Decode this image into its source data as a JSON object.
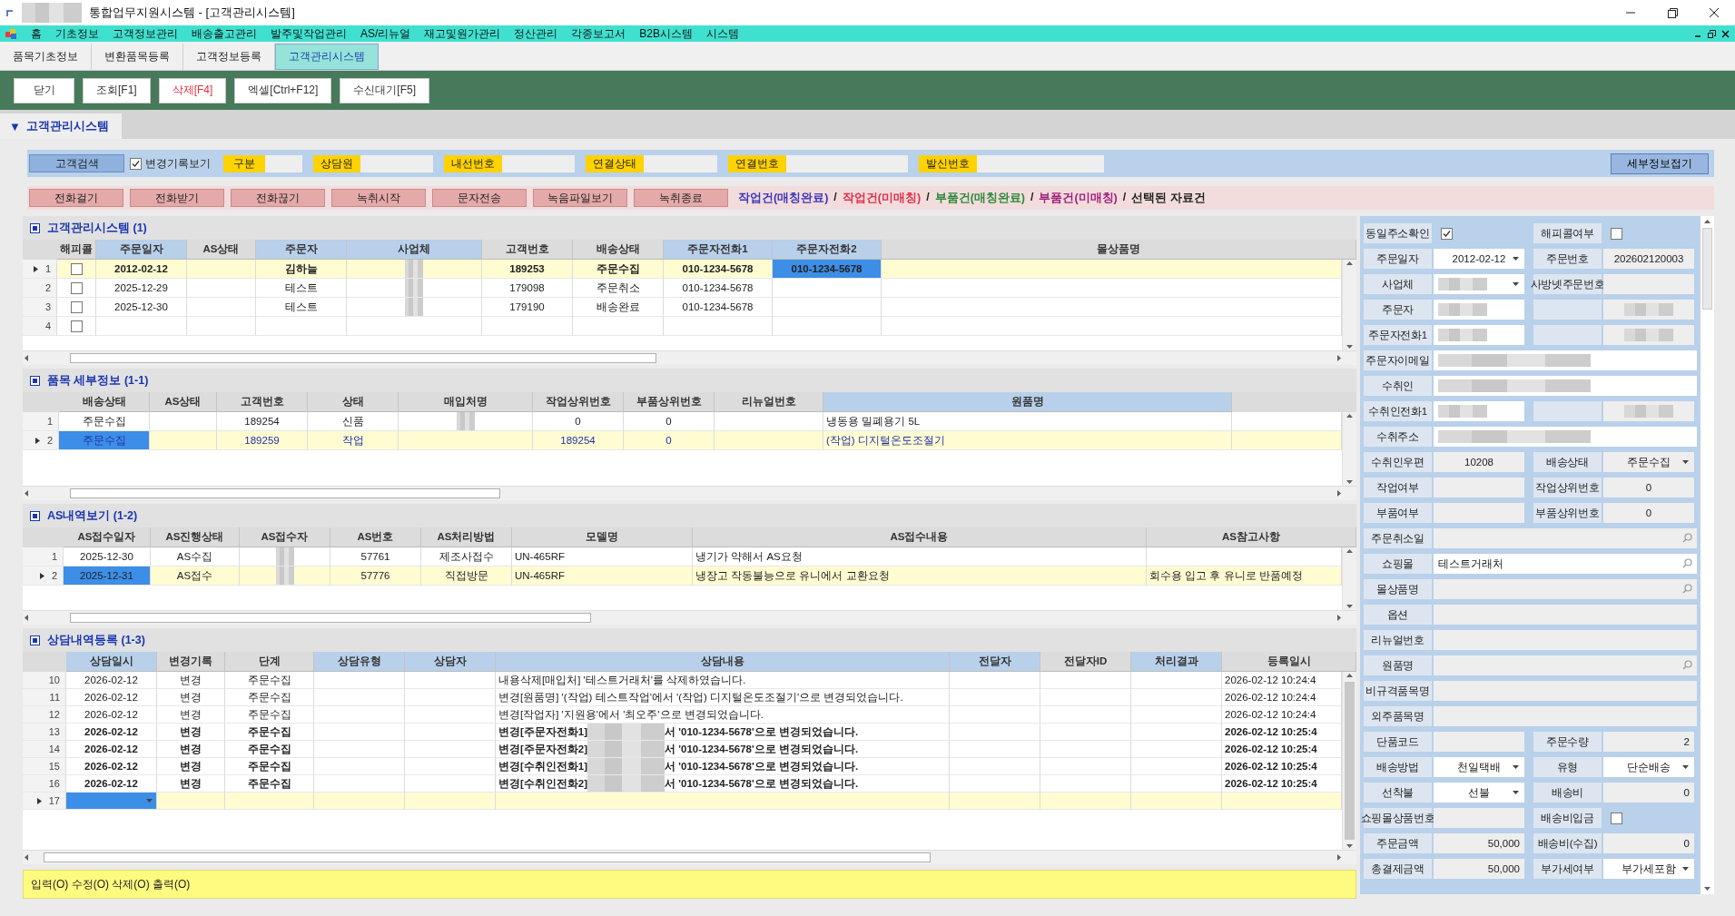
{
  "window": {
    "title": "통합업무지원시스템 - [고객관리시스템]"
  },
  "menu": [
    "홈",
    "기초정보",
    "고객정보관리",
    "배송출고관리",
    "발주및작업관리",
    "AS/리뉴얼",
    "재고및원가관리",
    "정산관리",
    "각종보고서",
    "B2B시스템",
    "시스템"
  ],
  "tabs": [
    {
      "label": "품목기초정보",
      "selected": false
    },
    {
      "label": "변환품목등록",
      "selected": false
    },
    {
      "label": "고객정보등록",
      "selected": false
    },
    {
      "label": "고객관리시스템",
      "selected": true
    }
  ],
  "toolbar": [
    {
      "label": "닫기",
      "kind": "normal"
    },
    {
      "label": "조회[F1]",
      "kind": "normal"
    },
    {
      "label": "삭제[F4]",
      "kind": "danger"
    },
    {
      "label": "엑셀[Ctrl+F12]",
      "kind": "normal"
    },
    {
      "label": "수신대기[F5]",
      "kind": "normal"
    }
  ],
  "section": {
    "arrow": "▼",
    "title": "고객관리시스템"
  },
  "search_bar": {
    "search_button": "고객검색",
    "history_checkbox": {
      "label": "변경기록보기",
      "checked": true
    },
    "filters": [
      "구분",
      "상담원",
      "내선번호",
      "연결상태",
      "연결번호",
      "발신번호"
    ],
    "collapse_button": "세부정보접기"
  },
  "call_buttons": [
    "전화걸기",
    "전화받기",
    "전화끊기",
    "녹취시작",
    "문자전송",
    "녹음파일보기",
    "녹취종료"
  ],
  "legend": [
    {
      "text": "작업건(매칭완료)",
      "kind": "item",
      "color": "#3b36b8"
    },
    {
      "text": "/",
      "kind": "separator"
    },
    {
      "text": "작업건(미매칭)",
      "kind": "item",
      "color": "#e0304a"
    },
    {
      "text": "/",
      "kind": "separator"
    },
    {
      "text": "부품건(매칭완료)",
      "kind": "item",
      "color": "#2a8a3a"
    },
    {
      "text": "/",
      "kind": "separator"
    },
    {
      "text": "부품건(미매칭)",
      "kind": "item",
      "color": "#a0207a"
    },
    {
      "text": "/",
      "kind": "separator"
    },
    {
      "text": "선택된 자료건",
      "kind": "item",
      "color": "#222222"
    }
  ],
  "grids": [
    {
      "title": "고객관리시스템 (1)",
      "columns": [
        {
          "label": "해피콜",
          "highlighted": false,
          "kind": "short"
        },
        {
          "label": "주문일자",
          "highlighted": true,
          "kind": "short"
        },
        {
          "label": "AS상태",
          "highlighted": false,
          "kind": "short"
        },
        {
          "label": "주문자",
          "highlighted": true,
          "kind": "short"
        },
        {
          "label": "사업체",
          "highlighted": true,
          "kind": "short"
        },
        {
          "label": "고객번호",
          "highlighted": false,
          "kind": "short"
        },
        {
          "label": "배송상태",
          "highlighted": false,
          "kind": "short"
        },
        {
          "label": "주문자전화1",
          "highlighted": true,
          "kind": "short"
        },
        {
          "label": "주문자전화2",
          "highlighted": true,
          "kind": "short"
        },
        {
          "label": "몰상품명",
          "highlighted": false,
          "kind": "long"
        }
      ],
      "rows": [
        {
          "num": "1",
          "selected": true,
          "bold": true,
          "cells": [
            {
              "kind": "check",
              "checked": false
            },
            "2012-02-12",
            null,
            "김하늘",
            {
              "kind": "blurred"
            },
            "189253",
            "주문수집",
            "010-1234-5678",
            {
              "text": "010-1234-5678",
              "focused": true
            },
            null
          ]
        },
        {
          "num": "2",
          "selected": false,
          "bold": false,
          "cells": [
            {
              "kind": "check",
              "checked": false
            },
            "2025-12-29",
            null,
            "테스트",
            {
              "kind": "blurred"
            },
            "179098",
            "주문취소",
            "010-1234-5678",
            null,
            null
          ]
        },
        {
          "num": "3",
          "selected": false,
          "bold": false,
          "cells": [
            {
              "kind": "check",
              "checked": false
            },
            "2025-12-30",
            null,
            "테스트",
            {
              "kind": "blurred"
            },
            "179190",
            "배송완료",
            "010-1234-5678",
            null,
            null
          ]
        },
        {
          "num": "4",
          "selected": false,
          "cells": [
            {
              "kind": "check",
              "checked": false
            }
          ]
        }
      ]
    },
    {
      "title": "품목 세부정보 (1-1)",
      "columns": [
        {
          "label": "배송상태",
          "highlighted": false,
          "kind": "short"
        },
        {
          "label": "AS상태",
          "highlighted": false,
          "kind": "short"
        },
        {
          "label": "고객번호",
          "highlighted": false,
          "kind": "short"
        },
        {
          "label": "상태",
          "highlighted": false,
          "kind": "short"
        },
        {
          "label": "매입처명",
          "highlighted": false,
          "kind": "short"
        },
        {
          "label": "작업상위번호",
          "highlighted": false,
          "kind": "short"
        },
        {
          "label": "부품상위번호",
          "highlighted": false,
          "kind": "short"
        },
        {
          "label": "리뉴얼번호",
          "highlighted": false,
          "kind": "short"
        },
        {
          "label": "원품명",
          "highlighted": true,
          "kind": "long"
        }
      ],
      "rows": [
        {
          "num": "1",
          "selected": false,
          "bold": false,
          "color": "#222222",
          "cells": [
            "주문수집",
            null,
            "189254",
            "신품",
            {
              "kind": "blurred"
            },
            "0",
            "0",
            null,
            "냉동용 밀폐용기 5L"
          ]
        },
        {
          "num": "2",
          "selected": true,
          "bold": false,
          "color": "#1f2fa8",
          "cells": [
            {
              "text": "주문수집",
              "focused": true
            },
            null,
            "189259",
            "작업",
            null,
            "189254",
            "0",
            null,
            "(작업) 디지털온도조절기"
          ]
        }
      ]
    },
    {
      "title": "AS내역보기 (1-2)",
      "columns": [
        {
          "label": "AS접수일자",
          "highlighted": false,
          "kind": "short"
        },
        {
          "label": "AS진행상태",
          "highlighted": false,
          "kind": "short"
        },
        {
          "label": "AS접수자",
          "highlighted": false,
          "kind": "short"
        },
        {
          "label": "AS번호",
          "highlighted": false,
          "kind": "short"
        },
        {
          "label": "AS처리방법",
          "highlighted": false,
          "kind": "short"
        },
        {
          "label": "모델명",
          "highlighted": false,
          "kind": "long"
        },
        {
          "label": "AS접수내용",
          "highlighted": false,
          "kind": "long"
        },
        {
          "label": "AS참고사항",
          "highlighted": false,
          "kind": "long"
        }
      ],
      "rows": [
        {
          "num": "1",
          "selected": false,
          "bold": false,
          "cells": [
            "2025-12-30",
            "AS수집",
            {
              "kind": "blurred"
            },
            "57761",
            "제조사접수",
            "UN-465RF",
            "냉기가 약해서 AS요청",
            null
          ]
        },
        {
          "num": "2",
          "selected": true,
          "bold": false,
          "cells": [
            {
              "text": "2025-12-31",
              "focused": true
            },
            "AS접수",
            {
              "kind": "blurred"
            },
            "57776",
            "직접방문",
            "UN-465RF",
            "냉장고 작동불능으로 유니에서 교환요청",
            "회수용 입고 후 유니로 반품예정"
          ]
        }
      ]
    },
    {
      "title": "상담내역등록 (1-3)",
      "columns": [
        {
          "label": "상담일시",
          "highlighted": true,
          "kind": "short"
        },
        {
          "label": "변경기록",
          "highlighted": false,
          "kind": "short"
        },
        {
          "label": "단계",
          "highlighted": false,
          "kind": "short"
        },
        {
          "label": "상담유형",
          "highlighted": true,
          "kind": "short"
        },
        {
          "label": "상담자",
          "highlighted": true,
          "kind": "short"
        },
        {
          "label": "상담내용",
          "highlighted": true,
          "kind": "long"
        },
        {
          "label": "전달자",
          "highlighted": true,
          "kind": "short"
        },
        {
          "label": "전달자ID",
          "highlighted": false,
          "kind": "short"
        },
        {
          "label": "처리결과",
          "highlighted": true,
          "kind": "short"
        },
        {
          "label": "등록일시",
          "highlighted": false,
          "kind": "long"
        }
      ],
      "rows": [
        {
          "num": "10",
          "selected": false,
          "bold": false,
          "cells": [
            "2026-02-12",
            "변경",
            "주문수집",
            null,
            null,
            "내용삭제[매입처] '테스트거래처'를 삭제하였습니다.",
            null,
            null,
            null,
            "2026-02-12 10:24:4"
          ]
        },
        {
          "num": "11",
          "selected": false,
          "bold": false,
          "cells": [
            "2026-02-12",
            "변경",
            "주문수집",
            null,
            null,
            "변경[원품명] '(작업) 테스트작업'에서 '(작업) 디지털온도조절기'으로 변경되었습니다.",
            null,
            null,
            null,
            "2026-02-12 10:24:4"
          ]
        },
        {
          "num": "12",
          "selected": false,
          "bold": false,
          "cells": [
            "2026-02-12",
            "변경",
            "주문수집",
            null,
            null,
            "변경[작업자] '지원용'에서 '최오주'으로 변경되었습니다.",
            null,
            null,
            null,
            "2026-02-12 10:24:4"
          ]
        },
        {
          "num": "13",
          "selected": false,
          "bold": true,
          "cells": [
            "2026-02-12",
            "변경",
            "주문수집",
            null,
            null,
            {
              "kind": "masked",
              "before": "변경[주문자전화1]",
              "after": "서 '010-1234-5678'으로 변경되었습니다."
            },
            null,
            null,
            null,
            "2026-02-12 10:25:4"
          ]
        },
        {
          "num": "14",
          "selected": false,
          "bold": true,
          "cells": [
            "2026-02-12",
            "변경",
            "주문수집",
            null,
            null,
            {
              "kind": "masked",
              "before": "변경[주문자전화2]",
              "after": "서 '010-1234-5678'으로 변경되었습니다."
            },
            null,
            null,
            null,
            "2026-02-12 10:25:4"
          ]
        },
        {
          "num": "15",
          "selected": false,
          "bold": true,
          "cells": [
            "2026-02-12",
            "변경",
            "주문수집",
            null,
            null,
            {
              "kind": "masked",
              "before": "변경[수취인전화1]",
              "after": "서 '010-1234-5678'으로 변경되었습니다."
            },
            null,
            null,
            null,
            "2026-02-12 10:25:4"
          ]
        },
        {
          "num": "16",
          "selected": false,
          "bold": true,
          "cells": [
            "2026-02-12",
            "변경",
            "주문수집",
            null,
            null,
            {
              "kind": "masked",
              "before": "변경[수취인전화2]",
              "after": "서 '010-1234-5678'으로 변경되었습니다."
            },
            null,
            null,
            null,
            "2026-02-12 10:25:4"
          ]
        },
        {
          "num": "17",
          "selected": true,
          "bold": false,
          "cells": [
            {
              "kind": "dropdown",
              "focused": true
            }
          ]
        }
      ]
    }
  ],
  "status_bar": "입력(O) 수정(O) 삭제(O) 출력(O)",
  "detail_panel": {
    "rows": [
      {
        "fields": [
          {
            "label": "동일주소확인",
            "kind": "check",
            "checked": true
          },
          {
            "label": "해피콜여부",
            "kind": "check",
            "checked": false
          }
        ]
      },
      {
        "fields": [
          {
            "label": "주문일자",
            "kind": "combo",
            "value": "2012-02-12",
            "editable": true
          },
          {
            "label": "주문번호",
            "kind": "text",
            "value": "202602120003",
            "editable": false
          }
        ]
      },
      {
        "fields": [
          {
            "label": "사업체",
            "kind": "combo_blurred",
            "editable": true
          },
          {
            "label": "사방넷주문번호",
            "kind": "text",
            "editable": false
          }
        ]
      },
      {
        "fields": [
          {
            "label": "주문자",
            "kind": "blurred",
            "editable": true
          },
          {
            "kind": "blurred_pair"
          }
        ]
      },
      {
        "fields": [
          {
            "label": "주문자전화1",
            "kind": "blurred",
            "editable": true
          },
          {
            "kind": "blurred_pair"
          }
        ]
      },
      {
        "fields": [
          {
            "label": "주문자이메일",
            "kind": "blurred",
            "editable": true
          }
        ]
      },
      {
        "fields": [
          {
            "label": "수취인",
            "kind": "blurred",
            "editable": true
          }
        ]
      },
      {
        "fields": [
          {
            "label": "수취인전화1",
            "kind": "blurred",
            "editable": true
          },
          {
            "kind": "blurred_pair"
          }
        ]
      },
      {
        "fields": [
          {
            "label": "수취주소",
            "kind": "blurred",
            "editable": true
          }
        ]
      },
      {
        "fields": [
          {
            "label": "수취인우편",
            "kind": "text",
            "value": "10208",
            "editable": false
          },
          {
            "label": "배송상태",
            "kind": "combo",
            "value": "주문수집",
            "editable": false
          }
        ]
      },
      {
        "fields": [
          {
            "label": "작업여부",
            "kind": "text",
            "editable": false
          },
          {
            "label": "작업상위번호",
            "kind": "text",
            "value": "0",
            "editable": false
          }
        ]
      },
      {
        "fields": [
          {
            "label": "부품여부",
            "kind": "text",
            "editable": false
          },
          {
            "label": "부품상위번호",
            "kind": "text",
            "value": "0",
            "editable": false
          }
        ]
      },
      {
        "fields": [
          {
            "label": "주문취소일",
            "kind": "search",
            "editable": false
          }
        ]
      },
      {
        "fields": [
          {
            "label": "쇼핑몰",
            "kind": "search",
            "value": "테스트거래처",
            "editable": true
          }
        ]
      },
      {
        "fields": [
          {
            "label": "몰상품명",
            "kind": "search",
            "editable": false
          }
        ]
      },
      {
        "fields": [
          {
            "label": "옵션",
            "kind": "text",
            "editable": false
          }
        ]
      },
      {
        "fields": [
          {
            "label": "리뉴얼번호",
            "kind": "text",
            "editable": false
          }
        ]
      },
      {
        "fields": [
          {
            "label": "원품명",
            "kind": "search",
            "editable": false
          }
        ]
      },
      {
        "fields": [
          {
            "label": "비규격품목명",
            "kind": "text",
            "editable": false
          }
        ]
      },
      {
        "fields": [
          {
            "label": "외주품목명",
            "kind": "text",
            "editable": false
          }
        ]
      },
      {
        "fields": [
          {
            "label": "단품코드",
            "kind": "text",
            "editable": false
          },
          {
            "label": "주문수량",
            "kind": "amount",
            "value": "2",
            "editable": false
          }
        ]
      },
      {
        "fields": [
          {
            "label": "배송방법",
            "kind": "combo",
            "value": "천일택배",
            "editable": true
          },
          {
            "label": "유형",
            "kind": "combo",
            "value": "단순배송",
            "editable": true
          }
        ]
      },
      {
        "fields": [
          {
            "label": "선착불",
            "kind": "combo",
            "value": "선불",
            "editable": true
          },
          {
            "label": "배송비",
            "kind": "amount",
            "value": "0",
            "editable": false
          }
        ]
      },
      {
        "fields": [
          {
            "label": "쇼핑몰상품번호",
            "kind": "text",
            "editable": false
          },
          {
            "label": "배송비입금",
            "kind": "check",
            "checked": false
          }
        ]
      },
      {
        "fields": [
          {
            "label": "주문금액",
            "kind": "amount",
            "value": "50,000",
            "editable": false
          },
          {
            "label": "배송비(수집)",
            "kind": "amount",
            "value": "0",
            "editable": false
          }
        ]
      },
      {
        "fields": [
          {
            "label": "총결제금액",
            "kind": "amount",
            "value": "50,000",
            "editable": false
          },
          {
            "label": "부가세여부",
            "kind": "combo",
            "value": "부가세포함",
            "editable": true
          }
        ]
      }
    ]
  }
}
